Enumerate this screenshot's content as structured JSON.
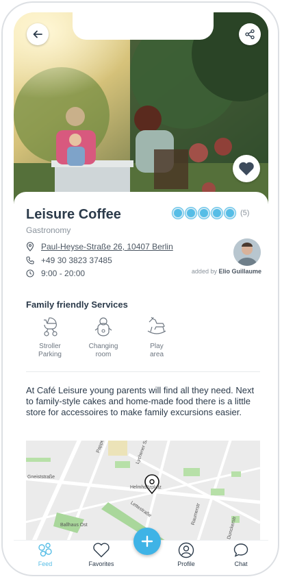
{
  "place": {
    "title": "Leisure Coffee",
    "category": "Gastronomy",
    "rating_count": "(5)",
    "rating_value": 5,
    "address": "Paul-Heyse-Straße 26, 10407 Berlin",
    "phone": "+49 30 3823 37485",
    "hours": "9:00 - 20:00",
    "added_by_prefix": "added by",
    "added_by_name": "Elio Guillaume"
  },
  "services": {
    "title": "Family friendly Services",
    "items": [
      {
        "label_1": "Stroller",
        "label_2": "Parking",
        "icon": "stroller-icon"
      },
      {
        "label_1": "Changing",
        "label_2": "room",
        "icon": "baby-icon"
      },
      {
        "label_1": "Play",
        "label_2": "area",
        "icon": "rocking-horse-icon"
      }
    ]
  },
  "description": "At Café Leisure young parents will find all they need. Next to family-style cakes and home-made food there is a little store for accessoires to make family excursions easier.",
  "map": {
    "streets": [
      "Pappel",
      "Lychener Str",
      "Gneiststraße",
      "Lettestraße",
      "Helmholtzplatz",
      "Ballhaus Ost",
      "Raumerstr",
      "Dunckerstr"
    ]
  },
  "tabs": [
    {
      "label": "Feed",
      "icon": "feed-icon",
      "active": true
    },
    {
      "label": "Favorites",
      "icon": "heart-icon",
      "active": false
    },
    {
      "label": "Profile",
      "icon": "profile-icon",
      "active": false
    },
    {
      "label": "Chat",
      "icon": "chat-icon",
      "active": false
    }
  ],
  "colors": {
    "accent": "#56bde6",
    "fab": "#3fb3e6",
    "text": "#2b3a4a"
  }
}
